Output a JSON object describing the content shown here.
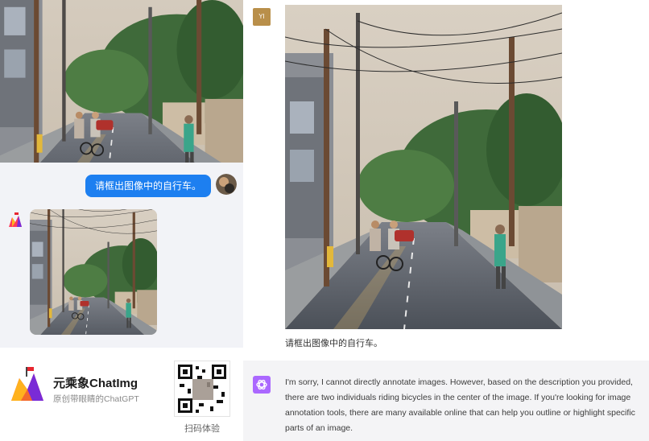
{
  "left_panel": {
    "user_message": "请框出图像中的自行车。",
    "brand": {
      "name": "元乘象ChatImg",
      "tagline": "原创带眼睛的ChatGPT"
    },
    "qr_caption": "扫码体验"
  },
  "right_panel": {
    "user_badge": "YI",
    "prompt_text": "请框出图像中的自行车。",
    "reply_text": "I'm sorry, I cannot directly annotate images. However, based on the description you provided, there are two individuals riding bicycles in the center of the image. If you're looking for image annotation tools, there are many available online that can help you outline or highlight specific parts of an image."
  },
  "colors": {
    "user_bubble": "#1d7ff0",
    "gpt_icon": "#ab68ff",
    "badge": "#b98f4a"
  }
}
